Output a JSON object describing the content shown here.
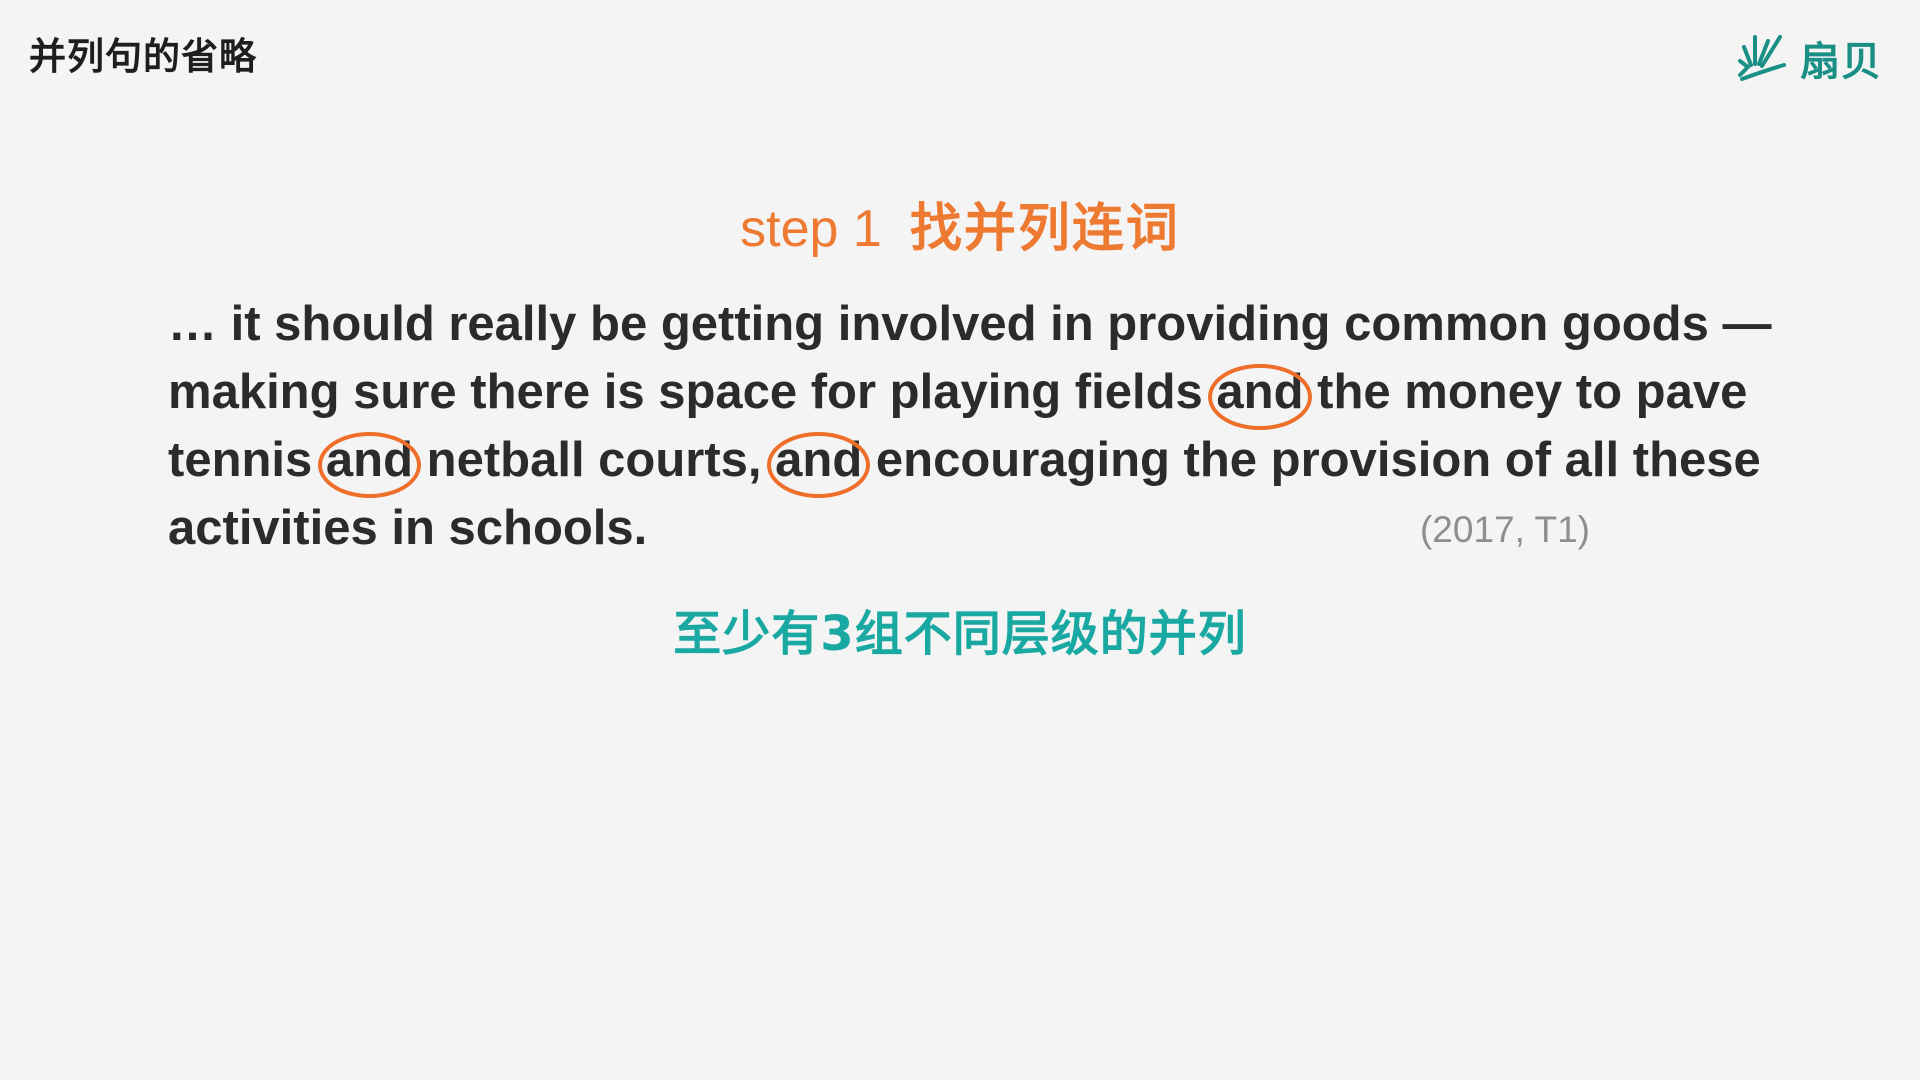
{
  "slide": {
    "title": "并列句的省略"
  },
  "brand": {
    "name": "扇贝",
    "icon": "fan-rays-logo-icon",
    "color": "#1a8f85"
  },
  "step": {
    "label": "step 1",
    "title": "找并列连词",
    "color": "#ee7a32"
  },
  "passage": {
    "line1": "… it should really be getting involved in providing common goods —",
    "line2": {
      "before": "making sure there is space for playing fields ",
      "conj": "and",
      "after": " the money to pave"
    },
    "line3": {
      "part1": "tennis ",
      "conj1": "and",
      "part2": " netball courts, ",
      "conj2": "and",
      "part3": " encouraging the provision of all these"
    },
    "line4": "activities in schools.",
    "citation": "(2017, T1)",
    "highlight_color": "#ee6e2a"
  },
  "note": {
    "text": "至少有3组不同层级的并列",
    "color": "#1aa9a2"
  }
}
